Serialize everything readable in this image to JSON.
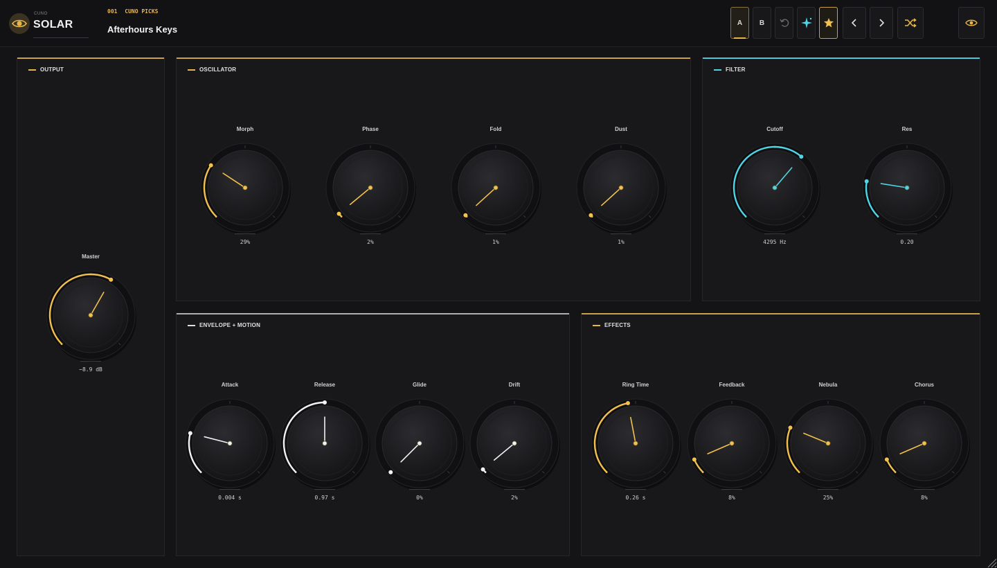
{
  "brand": {
    "small": "CUNO",
    "name": "SOLAR"
  },
  "preset": {
    "number": "001",
    "bank": "CUNO PICKS",
    "name": "Afterhours Keys"
  },
  "toolbar": {
    "a_label": "A",
    "b_label": "B"
  },
  "colors": {
    "gold": "#f2c14e",
    "cyan": "#4fd6e6",
    "white": "#f2f2f2",
    "gray": "#b8b8b8"
  },
  "panels": {
    "output": {
      "title": "OUTPUT"
    },
    "oscillator": {
      "title": "OSCILLATOR"
    },
    "filter": {
      "title": "FILTER"
    },
    "envelope": {
      "title": "ENVELOPE + MOTION"
    },
    "effects": {
      "title": "EFFECTS"
    }
  },
  "knobs": {
    "master": {
      "label": "Master",
      "value": "−8.9 dB",
      "level": 0.61,
      "color": "gold"
    },
    "morph": {
      "label": "Morph",
      "value": "29%",
      "level": 0.29,
      "color": "gold"
    },
    "phase": {
      "label": "Phase",
      "value": "2%",
      "level": 0.02,
      "color": "gold"
    },
    "fold": {
      "label": "Fold",
      "value": "1%",
      "level": 0.01,
      "color": "gold"
    },
    "dust": {
      "label": "Dust",
      "value": "1%",
      "level": 0.01,
      "color": "gold"
    },
    "cutoff": {
      "label": "Cutoff",
      "value": "4295 Hz",
      "level": 0.65,
      "color": "cyan"
    },
    "res": {
      "label": "Res",
      "value": "0.20",
      "level": 0.2,
      "color": "cyan"
    },
    "attack": {
      "label": "Attack",
      "value": "0.004 s",
      "level": 0.22,
      "color": "white"
    },
    "release": {
      "label": "Release",
      "value": "0.97 s",
      "level": 0.5,
      "color": "white"
    },
    "glide": {
      "label": "Glide",
      "value": "0%",
      "level": 0.0,
      "color": "white"
    },
    "drift": {
      "label": "Drift",
      "value": "2%",
      "level": 0.02,
      "color": "white"
    },
    "ring_time": {
      "label": "Ring Time",
      "value": "0.26 s",
      "level": 0.46,
      "color": "gold"
    },
    "feedback": {
      "label": "Feedback",
      "value": "8%",
      "level": 0.08,
      "color": "gold"
    },
    "nebula": {
      "label": "Nebula",
      "value": "25%",
      "level": 0.25,
      "color": "gold"
    },
    "chorus": {
      "label": "Chorus",
      "value": "8%",
      "level": 0.08,
      "color": "gold"
    }
  }
}
